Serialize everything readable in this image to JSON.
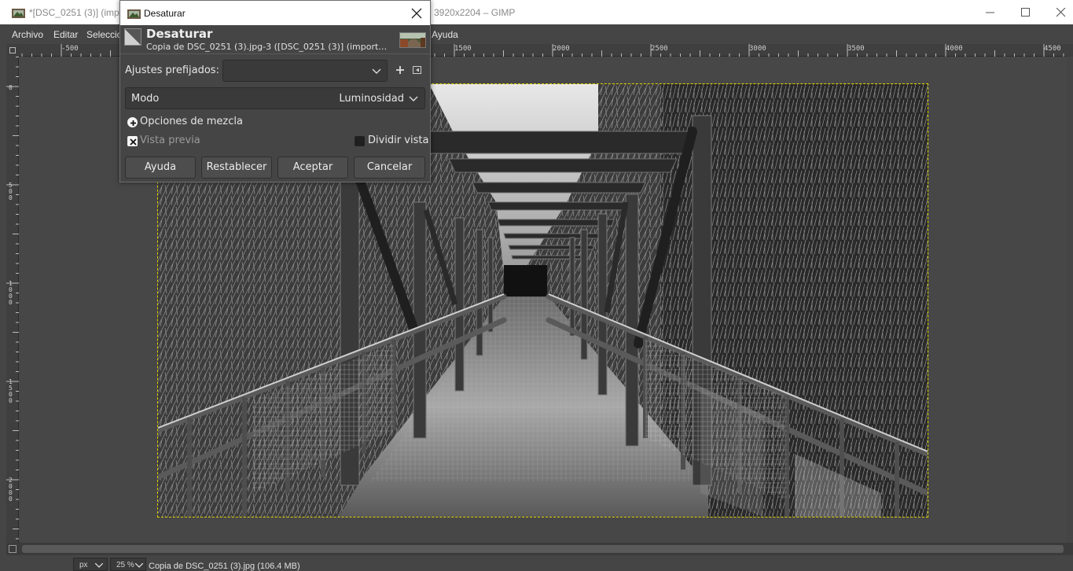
{
  "window": {
    "title_left": "*[DSC_0251 (3)] (impo",
    "title_right": "3920x2204 – GIMP"
  },
  "menubar": [
    "Archivo",
    "Editar",
    "Seleccio",
    "Ayuda"
  ],
  "ruler": {
    "top_labels": [
      "-500",
      "1500",
      "2000",
      "2500",
      "3000",
      "3500",
      "4000",
      "4500"
    ],
    "left_labels": [
      "0",
      "500",
      "1000",
      "1500",
      "2000"
    ]
  },
  "dialog": {
    "window_title": "Desaturar",
    "heading": "Desaturar",
    "subtitle": "Copia de DSC_0251 (3).jpg-3 ([DSC_0251 (3)] (import…",
    "presets_label": "Ajustes prefijados:",
    "presets_value": "",
    "mode_label": "Modo",
    "mode_value": "Luminosidad",
    "blend_options": "Opciones de mezcla",
    "preview_label": "Vista previa",
    "preview_checked": true,
    "split_label": "Dividir vista",
    "split_checked": false,
    "buttons": {
      "help": "Ayuda",
      "reset": "Restablecer",
      "ok": "Aceptar",
      "cancel": "Cancelar"
    }
  },
  "statusbar": {
    "unit": "px",
    "zoom": "25 %",
    "info": "Copia de DSC_0251 (3).jpg (106.4 MB)"
  }
}
